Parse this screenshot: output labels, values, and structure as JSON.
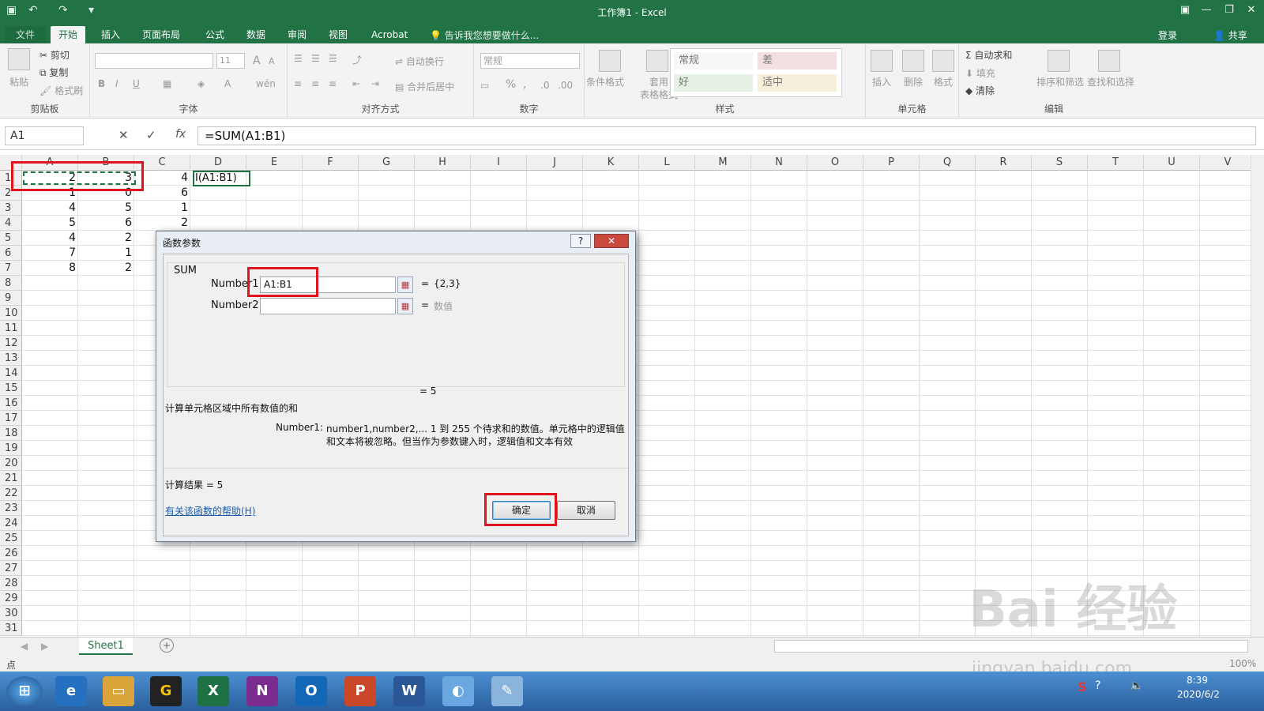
{
  "title_bar": {
    "title": "工作簿1 - Excel",
    "close": "✕",
    "minimize": "—",
    "restore": "❐",
    "ribbon_opt": "▣"
  },
  "tabs": [
    {
      "label": "文件"
    },
    {
      "label": "开始"
    },
    {
      "label": "插入"
    },
    {
      "label": "页面布局"
    },
    {
      "label": "公式"
    },
    {
      "label": "数据"
    },
    {
      "label": "审阅"
    },
    {
      "label": "视图"
    },
    {
      "label": "Acrobat"
    }
  ],
  "tell_me": "告诉我您想要做什么...",
  "account": {
    "login": "登录",
    "share": "共享"
  },
  "ribbon": {
    "clipboard": {
      "label": "剪贴板",
      "paste": "粘贴",
      "cut": "剪切",
      "copy": "复制",
      "format_painter": "格式刷"
    },
    "font": {
      "label": "字体",
      "size": "11",
      "bold": "B",
      "italic": "I",
      "underline": "U",
      "grow": "A",
      "shrink": "A"
    },
    "alignment": {
      "label": "对齐方式",
      "wrap": "自动换行",
      "merge": "合并后居中"
    },
    "number": {
      "label": "数字",
      "format": "常规",
      "percent": "%",
      "comma": ","
    },
    "styles": {
      "label": "样式",
      "conditional": "条件格式",
      "table_format_1": "套用",
      "table_format_2": "表格格式",
      "normal": "常规",
      "bad": "差",
      "good": "好",
      "neutral": "适中"
    },
    "cells": {
      "label": "单元格",
      "insert": "插入",
      "delete": "删除",
      "format": "格式"
    },
    "editing": {
      "label": "编辑",
      "autosum": "自动求和",
      "fill": "填充",
      "clear": "清除",
      "sort": "排序和筛选",
      "find": "查找和选择"
    }
  },
  "formula_bar": {
    "name_box": "A1",
    "cancel": "✕",
    "enter": "✓",
    "fx": "fx",
    "formula": "=SUM(A1:B1)"
  },
  "columns": [
    "A",
    "B",
    "C",
    "D",
    "E",
    "F",
    "G",
    "H",
    "I",
    "J",
    "K",
    "L",
    "M",
    "N",
    "O",
    "P",
    "Q",
    "R",
    "S",
    "T",
    "U",
    "V"
  ],
  "rows": [
    "1",
    "2",
    "3",
    "4",
    "5",
    "6",
    "7",
    "8",
    "9",
    "10",
    "11",
    "12",
    "13",
    "14",
    "15",
    "16",
    "17",
    "18",
    "19",
    "20",
    "21",
    "22",
    "23",
    "24",
    "25",
    "26",
    "27",
    "28",
    "29",
    "30",
    "31"
  ],
  "cells": {
    "A": [
      "2",
      "1",
      "4",
      "5",
      "4",
      "7",
      "8"
    ],
    "B": [
      "3",
      "0",
      "5",
      "6",
      "2",
      "1",
      "2"
    ],
    "C": [
      "4",
      "6",
      "1",
      "2",
      "",
      "",
      ""
    ],
    "D1": "I(A1:B1)"
  },
  "sheet": {
    "name": "Sheet1",
    "add": "+"
  },
  "status": {
    "mode": "点",
    "zoom": "100%"
  },
  "dialog": {
    "title": "函数参数",
    "help_btn": "?",
    "close_btn": "✕",
    "function_name": "SUM",
    "arg1_label": "Number1",
    "arg1_value": "A1:B1",
    "arg1_result": "{2,3}",
    "arg2_label": "Number2",
    "arg2_value": "",
    "arg2_result": "数值",
    "eq": "=",
    "eq_result": "= 5",
    "description": "计算单元格区域中所有数值的和",
    "arg_help_name": "Number1:",
    "arg_help_text_1": "number1,number2,...  1 到 255 个待求和的数值。单元格中的逻辑值",
    "arg_help_text_2": "和文本将被忽略。但当作为参数键入时，逻辑值和文本有效",
    "result_label": "计算结果 =  5",
    "help_link": "有关该函数的帮助(H)",
    "ok": "确定",
    "cancel": "取消"
  },
  "taskbar": {
    "time": "8:39",
    "date": "2020/6/2"
  },
  "watermark": "Bai 经验",
  "watermark_sub": "jingyan.baidu.com"
}
